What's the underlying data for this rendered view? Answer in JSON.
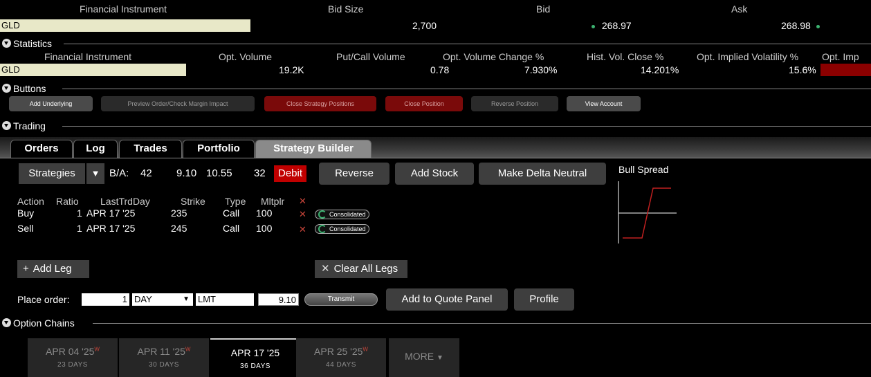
{
  "quote": {
    "headers": {
      "instrument": "Financial Instrument",
      "bid_size": "Bid Size",
      "bid": "Bid",
      "ask": "Ask"
    },
    "instrument": "GLD",
    "bid_size": "2,700",
    "bid": "268.97",
    "ask": "268.98"
  },
  "statistics": {
    "section_title": "Statistics",
    "headers": {
      "instrument": "Financial Instrument",
      "opt_volume": "Opt. Volume",
      "put_call": "Put/Call Volume",
      "vol_change": "Opt. Volume Change %",
      "hist_vol": "Hist. Vol. Close %",
      "implied_vol": "Opt. Implied Volatility %",
      "opt_imp": "Opt. Imp"
    },
    "instrument": "GLD",
    "opt_volume": "19.2K",
    "put_call": "0.78",
    "vol_change": "7.930%",
    "hist_vol": "14.201%",
    "implied_vol": "15.6%"
  },
  "buttons": {
    "section_title": "Buttons",
    "add_underlying": "Add Underlying",
    "preview_order": "Preview Order/Check Margin Impact",
    "close_strategy": "Close Strategy Positions",
    "close_position": "Close Position",
    "reverse_position": "Reverse Position",
    "view_account": "View Account"
  },
  "trading": {
    "section_title": "Trading",
    "tabs": [
      "Orders",
      "Log",
      "Trades",
      "Portfolio",
      "Strategy Builder"
    ],
    "active_tab": "Strategy Builder"
  },
  "strategy": {
    "strategies_label": "Strategies",
    "ba_label": "B/A:",
    "ba_bid_size": "42",
    "ba_bid": "9.10",
    "ba_ask": "10.55",
    "ba_ask_size": "32",
    "debit": "Debit",
    "reverse": "Reverse",
    "add_stock": "Add Stock",
    "delta_neutral": "Make Delta Neutral",
    "payoff_title": "Bull Spread",
    "leg_headers": {
      "action": "Action",
      "ratio": "Ratio",
      "last_trd_day": "LastTrdDay",
      "strike": "Strike",
      "type": "Type",
      "mltplr": "Mltplr"
    },
    "legs": [
      {
        "action": "Buy",
        "ratio": "1",
        "last_trd_day": "APR 17 '25",
        "strike": "235",
        "type": "Call",
        "mltplr": "100",
        "route": "Consolidated"
      },
      {
        "action": "Sell",
        "ratio": "1",
        "last_trd_day": "APR 17 '25",
        "strike": "245",
        "type": "Call",
        "mltplr": "100",
        "route": "Consolidated"
      }
    ],
    "add_leg": "Add Leg",
    "clear_legs": "Clear All Legs"
  },
  "order": {
    "place_label": "Place order:",
    "quantity": "1",
    "tif": "DAY",
    "order_type": "LMT",
    "limit_price": "9.10",
    "transmit": "Transmit",
    "add_quote_panel": "Add to Quote Panel",
    "profile": "Profile"
  },
  "option_chains": {
    "section_title": "Option Chains",
    "expiries": [
      {
        "date": "APR 04 '25",
        "weekly": "W",
        "days": "23 DAYS"
      },
      {
        "date": "APR 11 '25",
        "weekly": "W",
        "days": "30 DAYS"
      },
      {
        "date": "APR 17 '25",
        "weekly": "",
        "days": "36 DAYS"
      },
      {
        "date": "APR 25 '25",
        "weekly": "W",
        "days": "44 DAYS"
      }
    ],
    "more": "MORE"
  },
  "colors": {
    "accent_red": "#c00000",
    "green_dot": "#3cb371",
    "instrument_bg": "#e8e8c8"
  }
}
